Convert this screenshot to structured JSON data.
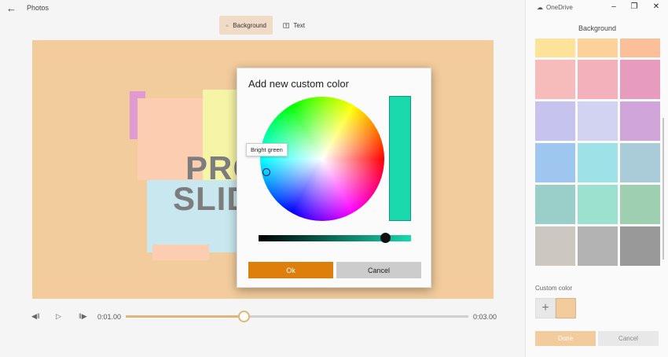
{
  "app": {
    "title": "Photos"
  },
  "toolbar": {
    "background_label": "Background",
    "text_label": "Text"
  },
  "canvas": {
    "text_line1": "PRO",
    "text_line2": "SLID"
  },
  "playback": {
    "current_time": "0:01.00",
    "total_time": "0:03.00",
    "progress": 0.33
  },
  "dialog": {
    "title": "Add new custom color",
    "tooltip": "Bright green",
    "ok_label": "Ok",
    "cancel_label": "Cancel",
    "selected_color": "#19d9ad"
  },
  "panel": {
    "onedrive_label": "OneDrive",
    "title": "Background",
    "custom_color_label": "Custom color",
    "custom_color": "#f2cc9c",
    "done_label": "Done",
    "cancel_label": "Cancel",
    "swatches": [
      "#fde39a",
      "#fdd19a",
      "#fbbf9a",
      "#f6bcbc",
      "#f2b1bb",
      "#e79cbd",
      "#c6c3ef",
      "#d2d3f1",
      "#d0a6da",
      "#9ec6ee",
      "#9ee2e8",
      "#a9ccd8",
      "#99cfc8",
      "#9ce0cf",
      "#9fcfb1",
      "#ccc7c0",
      "#b3b3b3",
      "#999999"
    ]
  }
}
